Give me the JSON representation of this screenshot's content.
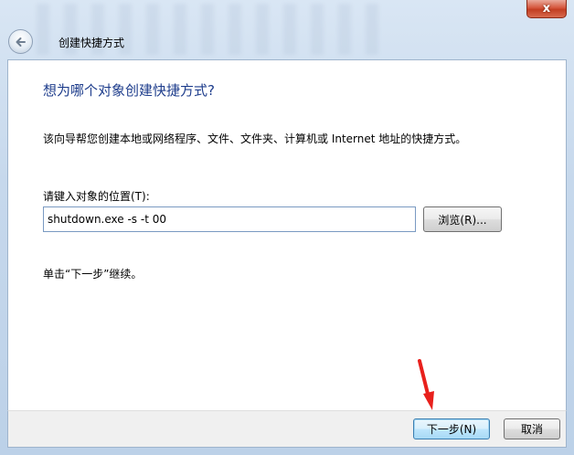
{
  "window": {
    "title": "创建快捷方式",
    "close_glyph": "x"
  },
  "wizard": {
    "heading": "想为哪个对象创建快捷方式?",
    "description": "该向导帮您创建本地或网络程序、文件、文件夹、计算机或 Internet 地址的快捷方式。",
    "location_label": "请键入对象的位置(T):",
    "location_value": "shutdown.exe -s -t 00",
    "browse_label": "浏览(R)...",
    "hint": "单击“下一步”继续。"
  },
  "footer": {
    "next_label": "下一步(N)",
    "cancel_label": "取消"
  },
  "colors": {
    "heading": "#1e3d8c",
    "annotation_arrow": "#e8201c",
    "close_button": "#c9462b"
  },
  "icons": {
    "back": "back-arrow-icon",
    "close": "close-icon",
    "annotation": "red-arrow-annotation"
  }
}
